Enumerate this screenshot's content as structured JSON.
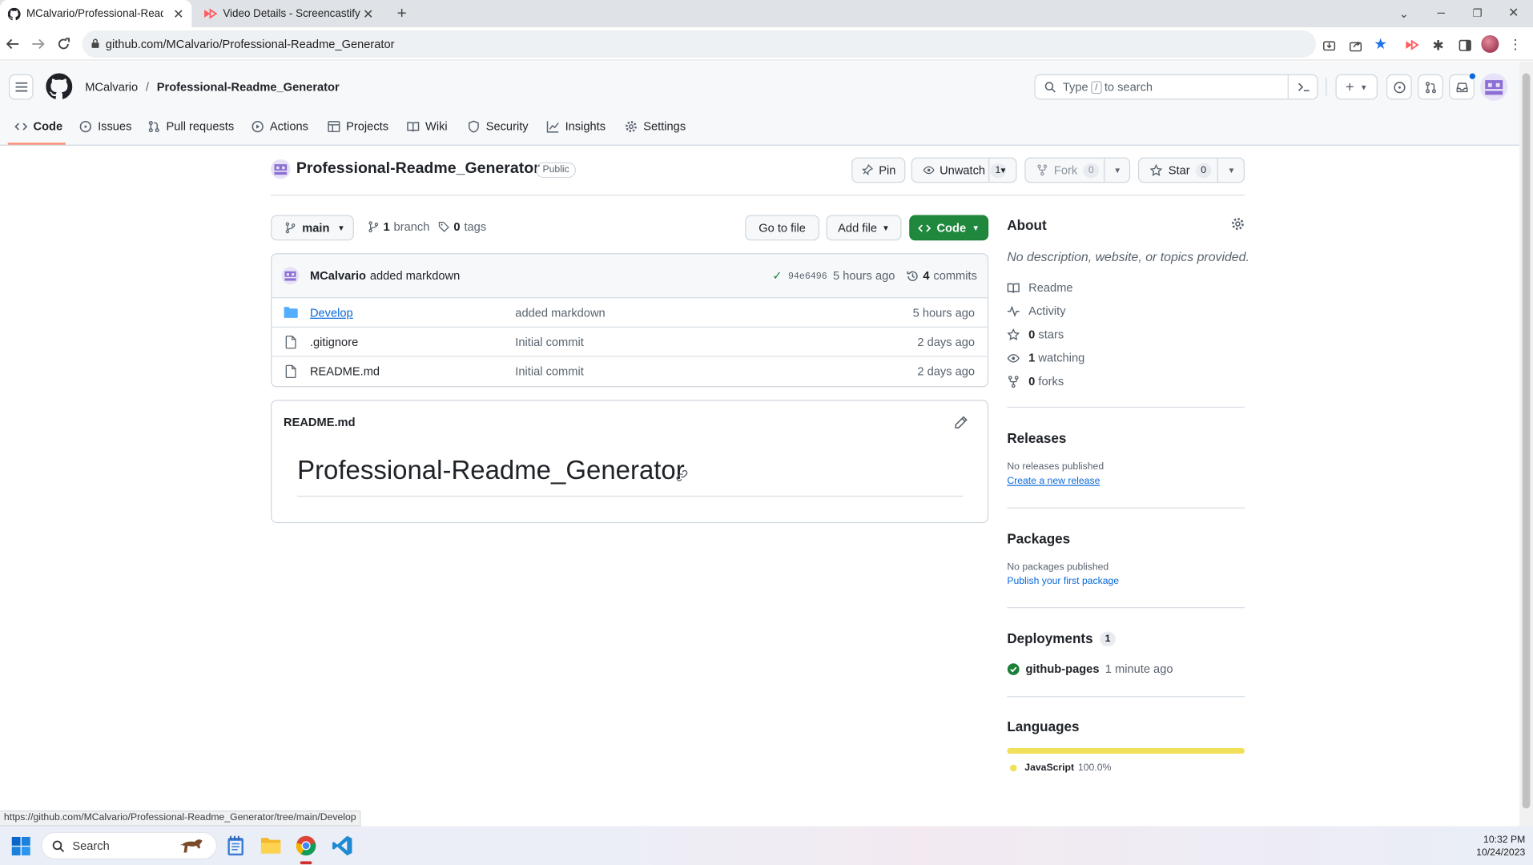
{
  "browser": {
    "tabs": [
      {
        "title": "MCalvario/Professional-Readme",
        "active": true
      },
      {
        "title": "Video Details - Screencastify",
        "active": false
      }
    ],
    "url": "github.com/MCalvario/Professional-Readme_Generator",
    "status_url": "https://github.com/MCalvario/Professional-Readme_Generator/tree/main/Develop"
  },
  "header": {
    "owner": "MCalvario",
    "separator": "/",
    "repo": "Professional-Readme_Generator",
    "search_placeholder_pre": "Type",
    "search_key": "/",
    "search_placeholder_post": "to search"
  },
  "nav": [
    {
      "label": "Code",
      "icon": "code-icon",
      "active": true
    },
    {
      "label": "Issues",
      "icon": "issue-icon"
    },
    {
      "label": "Pull requests",
      "icon": "pull-request-icon"
    },
    {
      "label": "Actions",
      "icon": "play-icon"
    },
    {
      "label": "Projects",
      "icon": "table-icon"
    },
    {
      "label": "Wiki",
      "icon": "book-icon"
    },
    {
      "label": "Security",
      "icon": "shield-icon"
    },
    {
      "label": "Insights",
      "icon": "graph-icon"
    },
    {
      "label": "Settings",
      "icon": "gear-icon"
    }
  ],
  "repo": {
    "name": "Professional-Readme_Generator",
    "visibility": "Public",
    "pin": "Pin",
    "unwatch": "Unwatch",
    "watch_count": "1",
    "fork": "Fork",
    "fork_count": "0",
    "star": "Star",
    "star_count": "0"
  },
  "branchbar": {
    "branch": "main",
    "branch_count": "1",
    "branch_label": "branch",
    "tag_count": "0",
    "tag_label": "tags",
    "go_to_file": "Go to file",
    "add_file": "Add file",
    "code": "Code"
  },
  "commit": {
    "author": "MCalvario",
    "message": "added markdown",
    "sha": "94e6496",
    "time": "5 hours ago",
    "commit_count": "4",
    "commit_label": "commits"
  },
  "files": [
    {
      "name": "Develop",
      "type": "folder",
      "message": "added markdown",
      "time": "5 hours ago"
    },
    {
      "name": ".gitignore",
      "type": "file",
      "message": "Initial commit",
      "time": "2 days ago"
    },
    {
      "name": "README.md",
      "type": "file",
      "message": "Initial commit",
      "time": "2 days ago"
    }
  ],
  "readme": {
    "filename": "README.md",
    "heading": "Professional-Readme_Generator"
  },
  "about": {
    "title": "About",
    "description": "No description, website, or topics provided.",
    "items": [
      {
        "icon": "book-icon",
        "label": "Readme"
      },
      {
        "icon": "pulse-icon",
        "label": "Activity"
      },
      {
        "icon": "star-icon",
        "count": "0",
        "label": "stars"
      },
      {
        "icon": "eye-icon",
        "count": "1",
        "label": "watching"
      },
      {
        "icon": "fork-icon",
        "count": "0",
        "label": "forks"
      }
    ]
  },
  "releases": {
    "title": "Releases",
    "text": "No releases published",
    "link": "Create a new release"
  },
  "packages": {
    "title": "Packages",
    "text": "No packages published",
    "link": "Publish your first package"
  },
  "deployments": {
    "title": "Deployments",
    "count": "1",
    "env": "github-pages",
    "time": "1 minute ago"
  },
  "languages": {
    "title": "Languages",
    "name": "JavaScript",
    "percent": "100.0%",
    "color": "#f1e05a"
  },
  "taskbar": {
    "search": "Search",
    "time": "10:32 PM",
    "date": "10/24/2023"
  },
  "colors": {
    "accent": "#fd8c73",
    "green": "#1f883d",
    "link": "#0969da"
  }
}
